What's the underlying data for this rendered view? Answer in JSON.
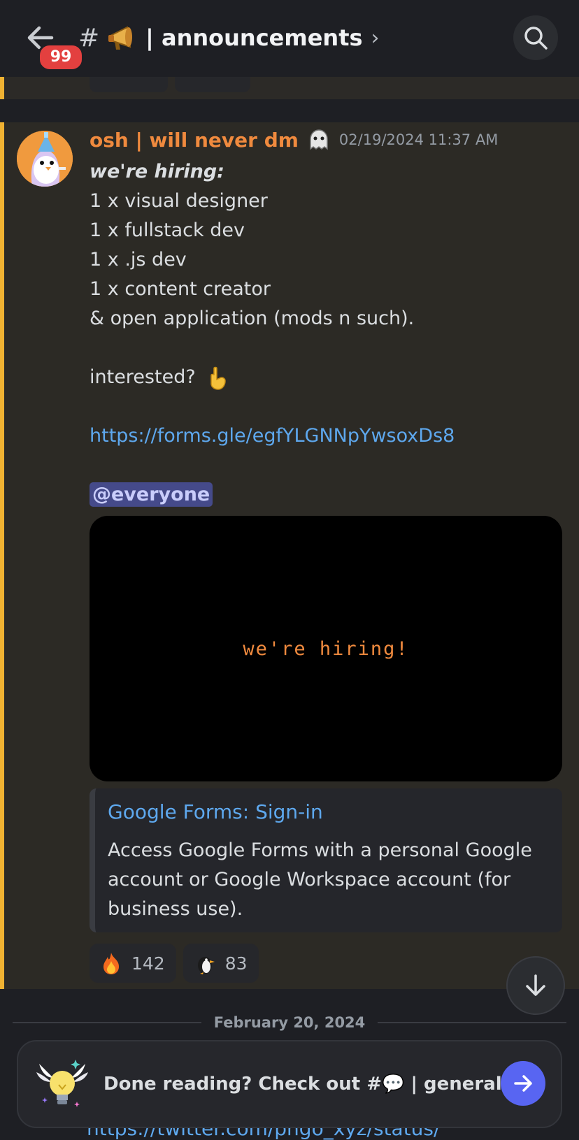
{
  "header": {
    "back_label": "Back",
    "unread_count": "99",
    "channel_prefix": "#",
    "channel_name": "| announcements",
    "chevron": "›",
    "search_label": "Search"
  },
  "message": {
    "author": "osh | will never dm",
    "timestamp": "02/19/2024 11:37 AM",
    "lines": [
      "we're hiring:",
      "1 x visual designer",
      "1 x fullstack dev",
      "1 x .js dev",
      "1 x content creator",
      "& open application (mods n such).",
      "interested?",
      "https://forms.gle/egfYLGNNpYwsoxDs8",
      "@everyone"
    ],
    "media_text": "we're hiring!",
    "embed": {
      "title": "Google Forms: Sign-in",
      "description": "Access Google Forms with a personal Google account or Google Workspace account (for business use)."
    },
    "reactions": [
      {
        "icon": "fire-icon",
        "count": "142"
      },
      {
        "icon": "penguin-icon",
        "count": "83"
      }
    ]
  },
  "date_divider": "February 20, 2024",
  "cta": {
    "text": "Done reading? Check out #💬 | general.",
    "icon": "winged-lightbulb-icon"
  },
  "bottom_peek_text": "https://twitter.com/pngo_xyz/status/",
  "colors": {
    "accent": "#5865f2",
    "author": "#f08a3e",
    "link": "#5ea8ee",
    "highlight_bar": "#f0b232",
    "badge": "#e3403f"
  }
}
